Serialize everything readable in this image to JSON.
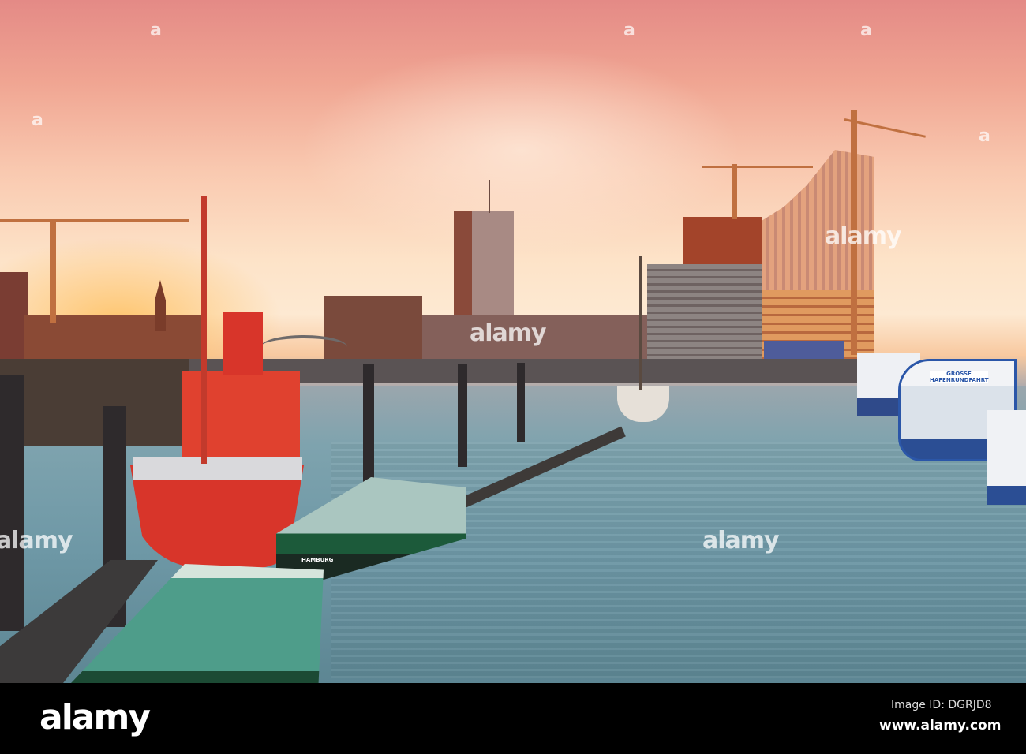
{
  "photo": {
    "boat_labels": {
      "ferry_sign": "GROSSE HAFENRUNDFAHRT",
      "barge_port": "HAMBURG"
    },
    "watermarks": {
      "center": "alamy",
      "left": "alamy",
      "right": "alamy",
      "bottom_right": "alamy",
      "corner_mark": "a"
    }
  },
  "footer": {
    "logo": "alamy",
    "image_id": "Image ID: DGRJD8",
    "url": "www.alamy.com"
  },
  "colors": {
    "sky_top": "#e48a86",
    "horizon": "#fde9d2",
    "water": "#6e98a6",
    "lightship": "#d8352a"
  }
}
